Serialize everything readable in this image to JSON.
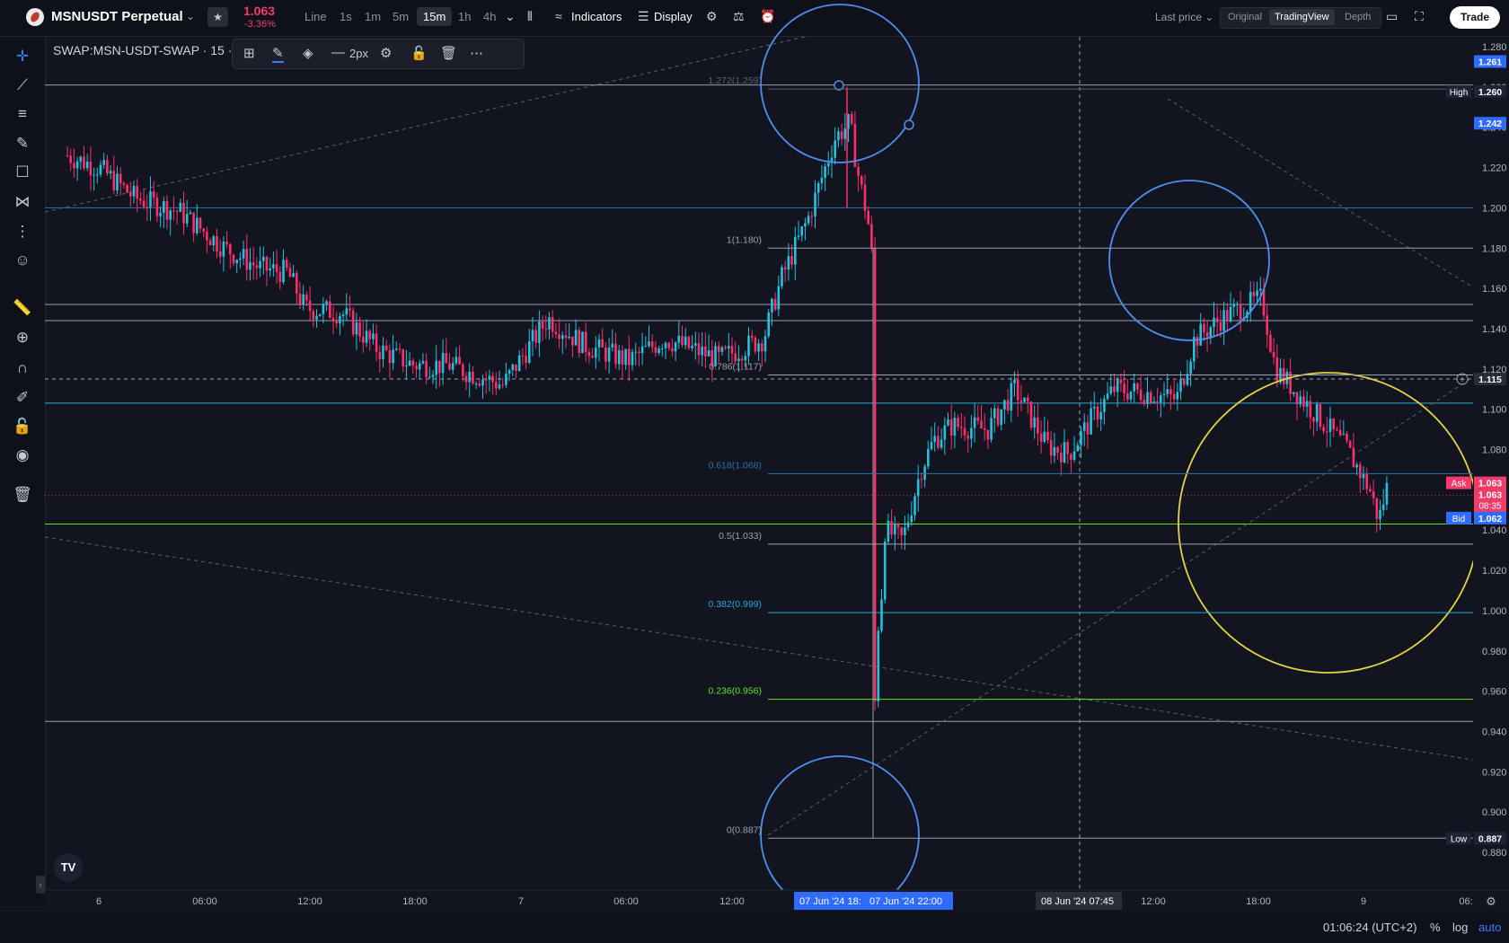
{
  "header": {
    "symbol": "MSNUSDT Perpetual",
    "price": "1.063",
    "change": "-3.36%",
    "timeframes": [
      "Line",
      "1s",
      "1m",
      "5m",
      "15m",
      "1h",
      "4h"
    ],
    "active_timeframe": "15m",
    "indicators_label": "Indicators",
    "display_label": "Display",
    "last_price_label": "Last price",
    "views": [
      "Original",
      "TradingView",
      "Depth"
    ],
    "active_view": "TradingView",
    "trade_label": "Trade"
  },
  "chart": {
    "title": "SWAP:MSN-USDT-SWAP · 15 ·",
    "stroke_width_label": "2px",
    "price_ticks": [
      "1.280",
      "1.260",
      "1.240",
      "1.220",
      "1.200",
      "1.180",
      "1.160",
      "1.140",
      "1.120",
      "1.100",
      "1.080",
      "1.060",
      "1.040",
      "1.020",
      "1.000",
      "0.980",
      "0.960",
      "0.940",
      "0.920",
      "0.900",
      "0.880"
    ],
    "time_ticks": [
      "6",
      "06:00",
      "12:00",
      "18:00",
      "7",
      "06:00",
      "12:00",
      "12:00",
      "18:00",
      "9",
      "06:"
    ],
    "crosshair_time": "08 Jun '24  07:45",
    "range_start": "07 Jun '24  18:",
    "range_end": "07 Jun '24  22:00",
    "tags": {
      "high_label": "High",
      "high_value": "1.260",
      "low_label": "Low",
      "low_value": "0.887",
      "line_1261": "1.261",
      "line_1242": "1.242",
      "cross": "1.115",
      "ask_label": "Ask",
      "ask_value": "1.063",
      "last_value": "1.063",
      "countdown": "08:35",
      "bid_label": "Bid",
      "bid_value": "1.062"
    },
    "fib_levels": [
      {
        "label": "1.272(1.259)",
        "value": 1.259,
        "color": "#5d6170"
      },
      {
        "label": "1(1.180)",
        "value": 1.18,
        "color": "#9aa0ac"
      },
      {
        "label": "0.786(1.117)",
        "value": 1.117,
        "color": "#9aa0ac"
      },
      {
        "label": "0.618(1.068)",
        "value": 1.068,
        "color": "#2f6fa8"
      },
      {
        "label": "0.5(1.033)",
        "value": 1.033,
        "color": "#9aa0ac"
      },
      {
        "label": "0.382(0.999)",
        "value": 0.999,
        "color": "#29a7d6"
      },
      {
        "label": "0.236(0.956)",
        "value": 0.956,
        "color": "#5ee41f"
      },
      {
        "label": "0(0.887)",
        "value": 0.887,
        "color": "#9aa0ac"
      }
    ],
    "colors": {
      "up": "#22c1dc",
      "down": "#ff2d6b",
      "accent": "#2f6bff",
      "yellow_circle": "#e6d342",
      "blue_circle": "#4d8ff0"
    }
  },
  "status": {
    "clock": "01:06:24 (UTC+2)",
    "percent": "%",
    "log": "log",
    "auto": "auto"
  }
}
